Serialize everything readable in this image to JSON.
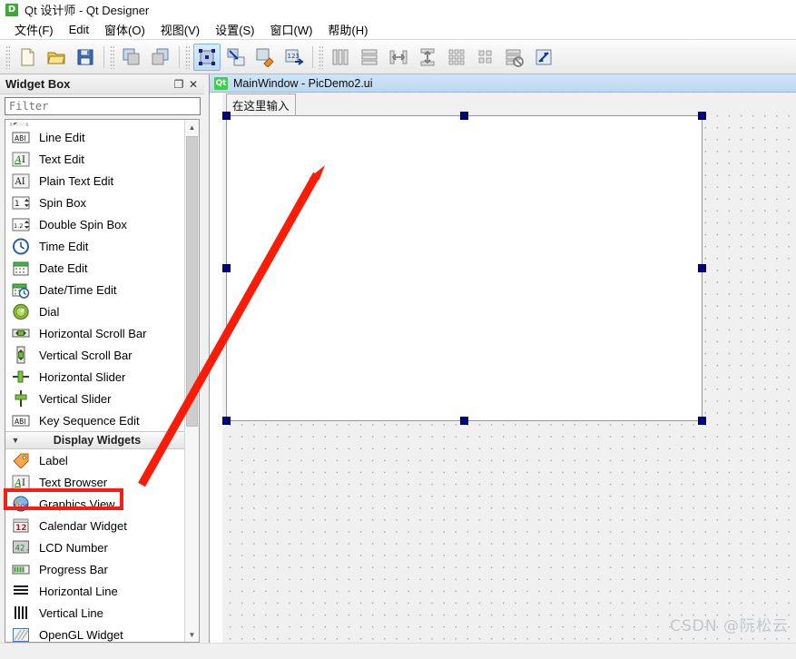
{
  "window": {
    "title": "Qt 设计师 - Qt Designer",
    "logo_text": "D"
  },
  "menubar": {
    "items": [
      {
        "label": "文件(F)",
        "name": "menu-file"
      },
      {
        "label": "Edit",
        "name": "menu-edit"
      },
      {
        "label": "窗体(O)",
        "name": "menu-form"
      },
      {
        "label": "视图(V)",
        "name": "menu-view"
      },
      {
        "label": "设置(S)",
        "name": "menu-settings"
      },
      {
        "label": "窗口(W)",
        "name": "menu-window"
      },
      {
        "label": "帮助(H)",
        "name": "menu-help"
      }
    ]
  },
  "toolbar": {
    "groups": [
      {
        "buttons": [
          {
            "name": "new-form-icon",
            "title": "New",
            "active": false
          },
          {
            "name": "open-form-icon",
            "title": "Open",
            "active": false
          },
          {
            "name": "save-form-icon",
            "title": "Save",
            "active": false
          }
        ]
      },
      {
        "buttons": [
          {
            "name": "undo-icon",
            "title": "Undo",
            "active": false
          },
          {
            "name": "redo-icon",
            "title": "Redo",
            "active": false
          }
        ]
      },
      {
        "buttons": [
          {
            "name": "edit-widgets-icon",
            "title": "Edit Widgets",
            "active": true
          },
          {
            "name": "edit-signals-slots-icon",
            "title": "Edit Signals/Slots",
            "active": false
          },
          {
            "name": "edit-buddies-icon",
            "title": "Edit Buddies",
            "active": false
          },
          {
            "name": "edit-tab-order-icon",
            "title": "Edit Tab Order",
            "active": false
          }
        ]
      },
      {
        "buttons": [
          {
            "name": "layout-horizontally-icon",
            "title": "Lay Out Horizontally",
            "active": false
          },
          {
            "name": "layout-vertically-icon",
            "title": "Lay Out Vertically",
            "active": false
          },
          {
            "name": "layout-splitter-h-icon",
            "title": "Lay Out in Splitter Horizontally",
            "active": false
          },
          {
            "name": "layout-splitter-v-icon",
            "title": "Lay Out in Splitter Vertically",
            "active": false
          },
          {
            "name": "layout-grid-icon",
            "title": "Lay Out in Grid",
            "active": false
          },
          {
            "name": "layout-form-icon",
            "title": "Lay Out in Form Layout",
            "active": false
          },
          {
            "name": "break-layout-icon",
            "title": "Break Layout",
            "active": false
          },
          {
            "name": "adjust-size-icon",
            "title": "Adjust Size",
            "active": false
          }
        ]
      }
    ]
  },
  "widget_box": {
    "title": "Widget Box",
    "undock_label": "❐",
    "close_label": "✕",
    "filter": {
      "value": "",
      "placeholder": "Filter"
    },
    "items": [
      {
        "label": "Line Edit",
        "icon": "line-edit-icon",
        "type": "item"
      },
      {
        "label": "Text Edit",
        "icon": "text-edit-icon",
        "type": "item"
      },
      {
        "label": "Plain Text Edit",
        "icon": "plain-text-edit-icon",
        "type": "item"
      },
      {
        "label": "Spin Box",
        "icon": "spin-box-icon",
        "type": "item"
      },
      {
        "label": "Double Spin Box",
        "icon": "double-spin-box-icon",
        "type": "item"
      },
      {
        "label": "Time Edit",
        "icon": "time-edit-icon",
        "type": "item"
      },
      {
        "label": "Date Edit",
        "icon": "date-edit-icon",
        "type": "item"
      },
      {
        "label": "Date/Time Edit",
        "icon": "date-time-edit-icon",
        "type": "item"
      },
      {
        "label": "Dial",
        "icon": "dial-icon",
        "type": "item"
      },
      {
        "label": "Horizontal Scroll Bar",
        "icon": "horizontal-scroll-bar-icon",
        "type": "item"
      },
      {
        "label": "Vertical Scroll Bar",
        "icon": "vertical-scroll-bar-icon",
        "type": "item"
      },
      {
        "label": "Horizontal Slider",
        "icon": "horizontal-slider-icon",
        "type": "item"
      },
      {
        "label": "Vertical Slider",
        "icon": "vertical-slider-icon",
        "type": "item"
      },
      {
        "label": "Key Sequence Edit",
        "icon": "key-sequence-edit-icon",
        "type": "item"
      },
      {
        "label": "Display Widgets",
        "icon": "chevron-down-icon",
        "type": "section"
      },
      {
        "label": "Label",
        "icon": "label-icon",
        "type": "item"
      },
      {
        "label": "Text Browser",
        "icon": "text-browser-icon",
        "type": "item"
      },
      {
        "label": "Graphics View",
        "icon": "graphics-view-icon",
        "type": "item",
        "highlighted": true
      },
      {
        "label": "Calendar Widget",
        "icon": "calendar-widget-icon",
        "type": "item"
      },
      {
        "label": "LCD Number",
        "icon": "lcd-number-icon",
        "type": "item"
      },
      {
        "label": "Progress Bar",
        "icon": "progress-bar-icon",
        "type": "item"
      },
      {
        "label": "Horizontal Line",
        "icon": "horizontal-line-icon",
        "type": "item"
      },
      {
        "label": "Vertical Line",
        "icon": "vertical-line-icon",
        "type": "item"
      },
      {
        "label": "OpenGL Widget",
        "icon": "opengl-widget-icon",
        "type": "item"
      }
    ],
    "scrollbar": {
      "up_arrow": "▲",
      "down_arrow": "▼"
    }
  },
  "form_editor": {
    "title": "MainWindow - PicDemo2.ui",
    "badge": "Qt",
    "menu_placeholder": "在这里输入",
    "selection_handles": 8
  },
  "annotations": {
    "highlight_color": "#f81d12",
    "arrow_color": "#fb1c08",
    "highlight_target": "Graphics View"
  },
  "watermark": {
    "text": "CSDN @阮松云"
  }
}
